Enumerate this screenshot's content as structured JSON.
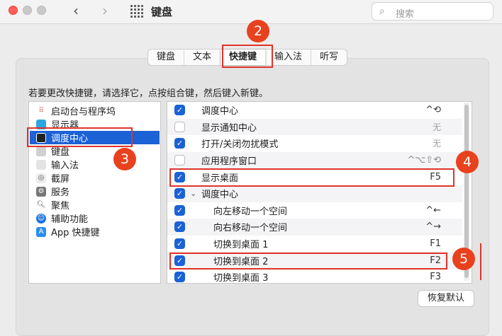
{
  "window": {
    "title": "键盘",
    "back_icon": "chevron-left-icon",
    "forward_icon": "chevron-right-icon",
    "search_placeholder": "搜索"
  },
  "tabs": [
    {
      "label": "键盘",
      "active": false
    },
    {
      "label": "文本",
      "active": false
    },
    {
      "label": "快捷键",
      "active": true
    },
    {
      "label": "输入法",
      "active": false
    },
    {
      "label": "听写",
      "active": false
    }
  ],
  "instruction": "若要更改快捷键，请选择它，点按组合键，然后键入新键。",
  "categories": [
    {
      "label": "启动台与程序坞",
      "icon": "launchpad-icon",
      "selected": false
    },
    {
      "label": "显示器",
      "icon": "display-icon",
      "selected": false
    },
    {
      "label": "调度中心",
      "icon": "mission-control-icon",
      "selected": true
    },
    {
      "label": "键盘",
      "icon": "keyboard-icon",
      "selected": false
    },
    {
      "label": "输入法",
      "icon": "input-method-icon",
      "selected": false
    },
    {
      "label": "截屏",
      "icon": "screenshot-icon",
      "selected": false
    },
    {
      "label": "服务",
      "icon": "services-icon",
      "selected": false
    },
    {
      "label": "聚焦",
      "icon": "spotlight-icon",
      "selected": false
    },
    {
      "label": "辅助功能",
      "icon": "accessibility-icon",
      "selected": false
    },
    {
      "label": "App 快捷键",
      "icon": "app-store-icon",
      "selected": false
    }
  ],
  "shortcuts": [
    {
      "label": "调度中心",
      "key": "^⟲",
      "checked": true,
      "group": false
    },
    {
      "label": "显示通知中心",
      "key": "无",
      "checked": false,
      "group": false
    },
    {
      "label": "打开/关闭勿扰模式",
      "key": "无",
      "checked": true,
      "group": false
    },
    {
      "label": "应用程序窗口",
      "key": "^⌥⇧⟲",
      "checked": false,
      "group": false
    },
    {
      "label": "显示桌面",
      "key": "F5",
      "checked": true,
      "group": false
    },
    {
      "label": "调度中心",
      "key": "",
      "checked": true,
      "group": true
    },
    {
      "label": "向左移动一个空间",
      "key": "^←",
      "checked": true,
      "group": false,
      "sub": true
    },
    {
      "label": "向右移动一个空间",
      "key": "^→",
      "checked": true,
      "group": false,
      "sub": true
    },
    {
      "label": "切换到桌面 1",
      "key": "F1",
      "checked": true,
      "group": false,
      "sub": true
    },
    {
      "label": "切换到桌面 2",
      "key": "F2",
      "checked": true,
      "group": false,
      "sub": true
    },
    {
      "label": "切换到桌面 3",
      "key": "F3",
      "checked": true,
      "group": false,
      "sub": true
    }
  ],
  "restore_button": "恢复默认",
  "annotations": [
    "2",
    "3",
    "4",
    "5"
  ],
  "colors": {
    "accent": "#1a62d6",
    "annotation": "#e0332a"
  }
}
